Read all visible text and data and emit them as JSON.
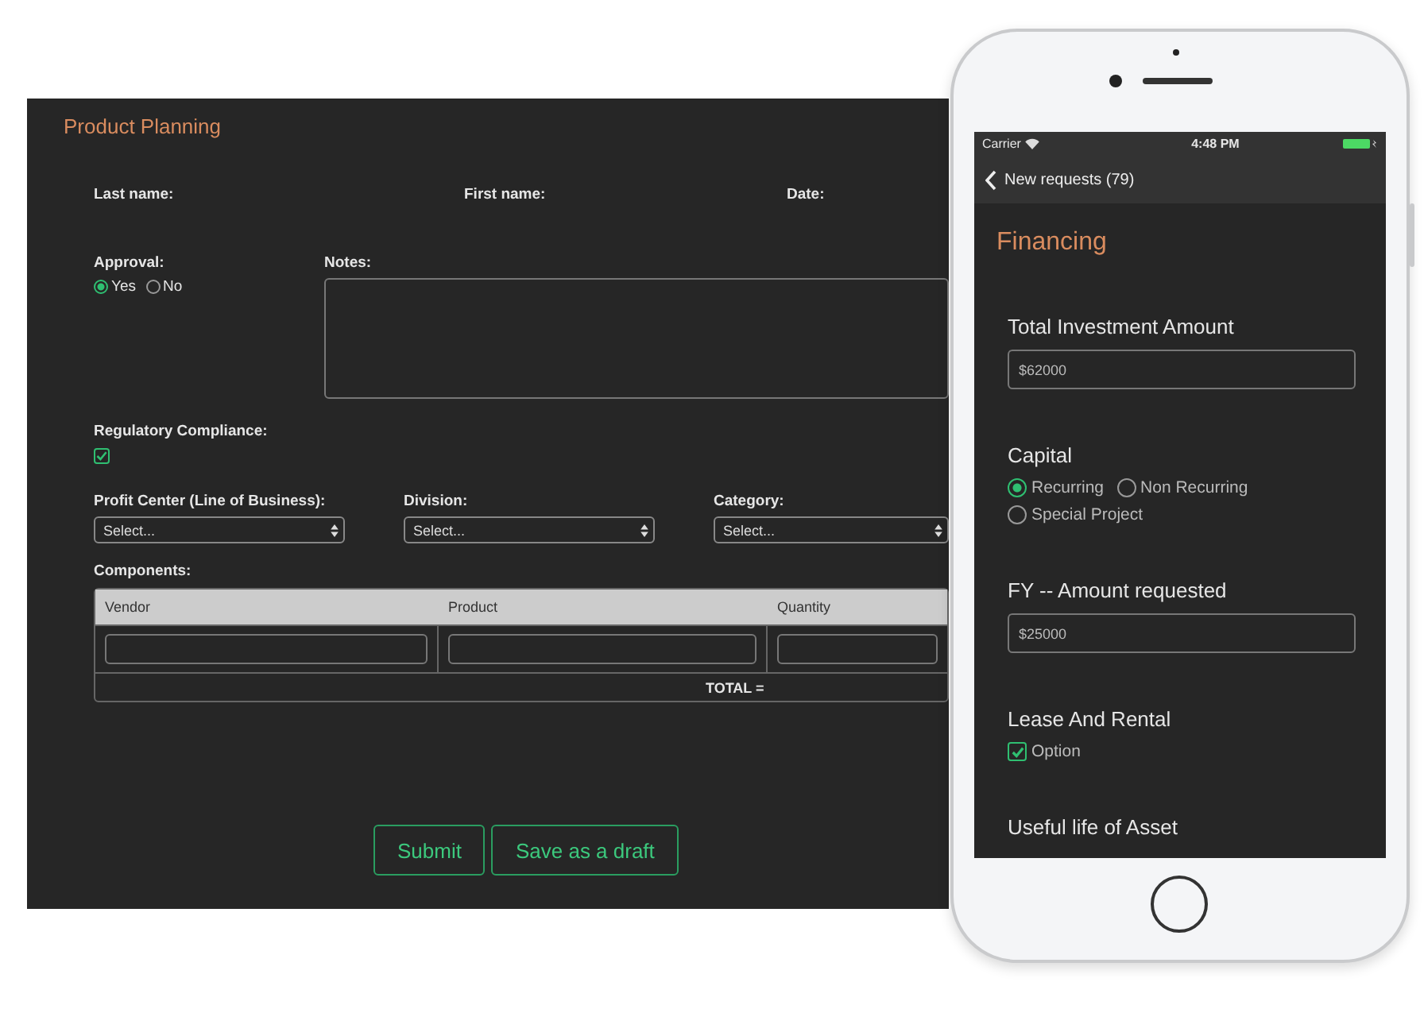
{
  "desktop": {
    "title": "Product Planning",
    "name_fields": [
      {
        "label": "Last name:"
      },
      {
        "label": "First name:"
      },
      {
        "label": "Date:"
      }
    ],
    "approval": {
      "label": "Approval:",
      "options": [
        {
          "label": "Yes",
          "selected": true
        },
        {
          "label": "No",
          "selected": false
        }
      ]
    },
    "notes": {
      "label": "Notes:"
    },
    "regulatory": {
      "label": "Regulatory Compliance:",
      "checked": true
    },
    "selects": [
      {
        "label": "Profit Center (Line of Business):",
        "value": "Select..."
      },
      {
        "label": "Division:",
        "value": "Select..."
      },
      {
        "label": "Category:",
        "value": "Select..."
      }
    ],
    "components": {
      "label": "Components:",
      "columns": [
        "Vendor",
        "Product",
        "Quantity"
      ],
      "total_label": "TOTAL ="
    },
    "buttons": [
      "Submit",
      "Save as a draft"
    ]
  },
  "phone": {
    "status_bar": {
      "carrier": "Carrier",
      "time": "4:48 PM"
    },
    "nav": {
      "back_label": "New requests (79)"
    },
    "title": "Financing",
    "sections": [
      {
        "kind": "field",
        "label": "Total Investment Amount",
        "value": "$62000"
      },
      {
        "kind": "radio",
        "label": "Capital",
        "options": [
          {
            "label": "Recurring",
            "selected": true
          },
          {
            "label": "Non Recurring",
            "selected": false
          },
          {
            "label": "Special Project",
            "selected": false
          }
        ]
      },
      {
        "kind": "field",
        "label": "FY -- Amount requested",
        "value": "$25000"
      },
      {
        "kind": "checkbox",
        "label": "Lease And Rental",
        "options": [
          {
            "label": "Option",
            "checked": true
          }
        ]
      },
      {
        "kind": "heading",
        "label": "Useful life of Asset"
      }
    ]
  }
}
